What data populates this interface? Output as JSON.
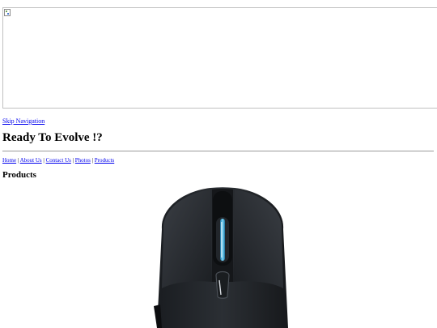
{
  "banner": {
    "icon": "broken-image-icon"
  },
  "skip_navigation": "Skip Navigation",
  "title": "Ready To Evolve !?",
  "nav": {
    "links": [
      "Home",
      "About Us",
      "Contact Us",
      "Photos",
      "Products"
    ],
    "separator": "|"
  },
  "section_heading": "Products",
  "product_image": {
    "icon": "gaming-mouse-image",
    "accent_color": "#3fb6e8"
  }
}
